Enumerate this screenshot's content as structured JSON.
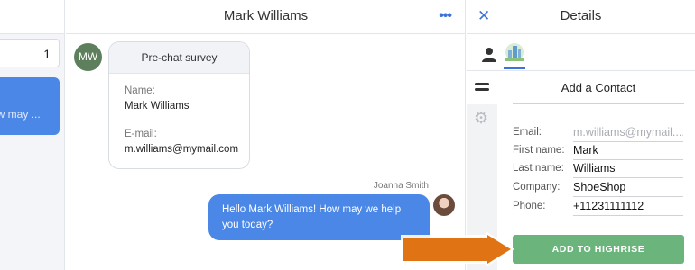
{
  "left_panel": {
    "count": "1",
    "preview_text": "ow may ..."
  },
  "chat": {
    "title": "Mark Williams",
    "more_icon": "more-dots-icon",
    "customer_initials": "MW",
    "survey": {
      "heading": "Pre-chat survey",
      "name_label": "Name:",
      "name_value": "Mark Williams",
      "email_label": "E-mail:",
      "email_value": "m.williams@mymail.com"
    },
    "agent_name": "Joanna Smith",
    "message": "Hello Mark Williams! How may we help you today?"
  },
  "details": {
    "title": "Details",
    "close_icon": "close-icon",
    "form_title": "Add a Contact",
    "fields": [
      {
        "label": "Email:",
        "value": "m.williams@mymail....",
        "placeholder": true
      },
      {
        "label": "First name:",
        "value": "Mark",
        "placeholder": false
      },
      {
        "label": "Last name:",
        "value": "Williams",
        "placeholder": false
      },
      {
        "label": "Company:",
        "value": "ShoeShop",
        "placeholder": false
      },
      {
        "label": "Phone:",
        "value": "+11231111112",
        "placeholder": false
      }
    ],
    "add_button": "ADD TO HIGHRISE"
  },
  "colors": {
    "accent_blue": "#4a87e6",
    "button_green": "#6bb57c",
    "arrow_orange": "#e07414"
  }
}
